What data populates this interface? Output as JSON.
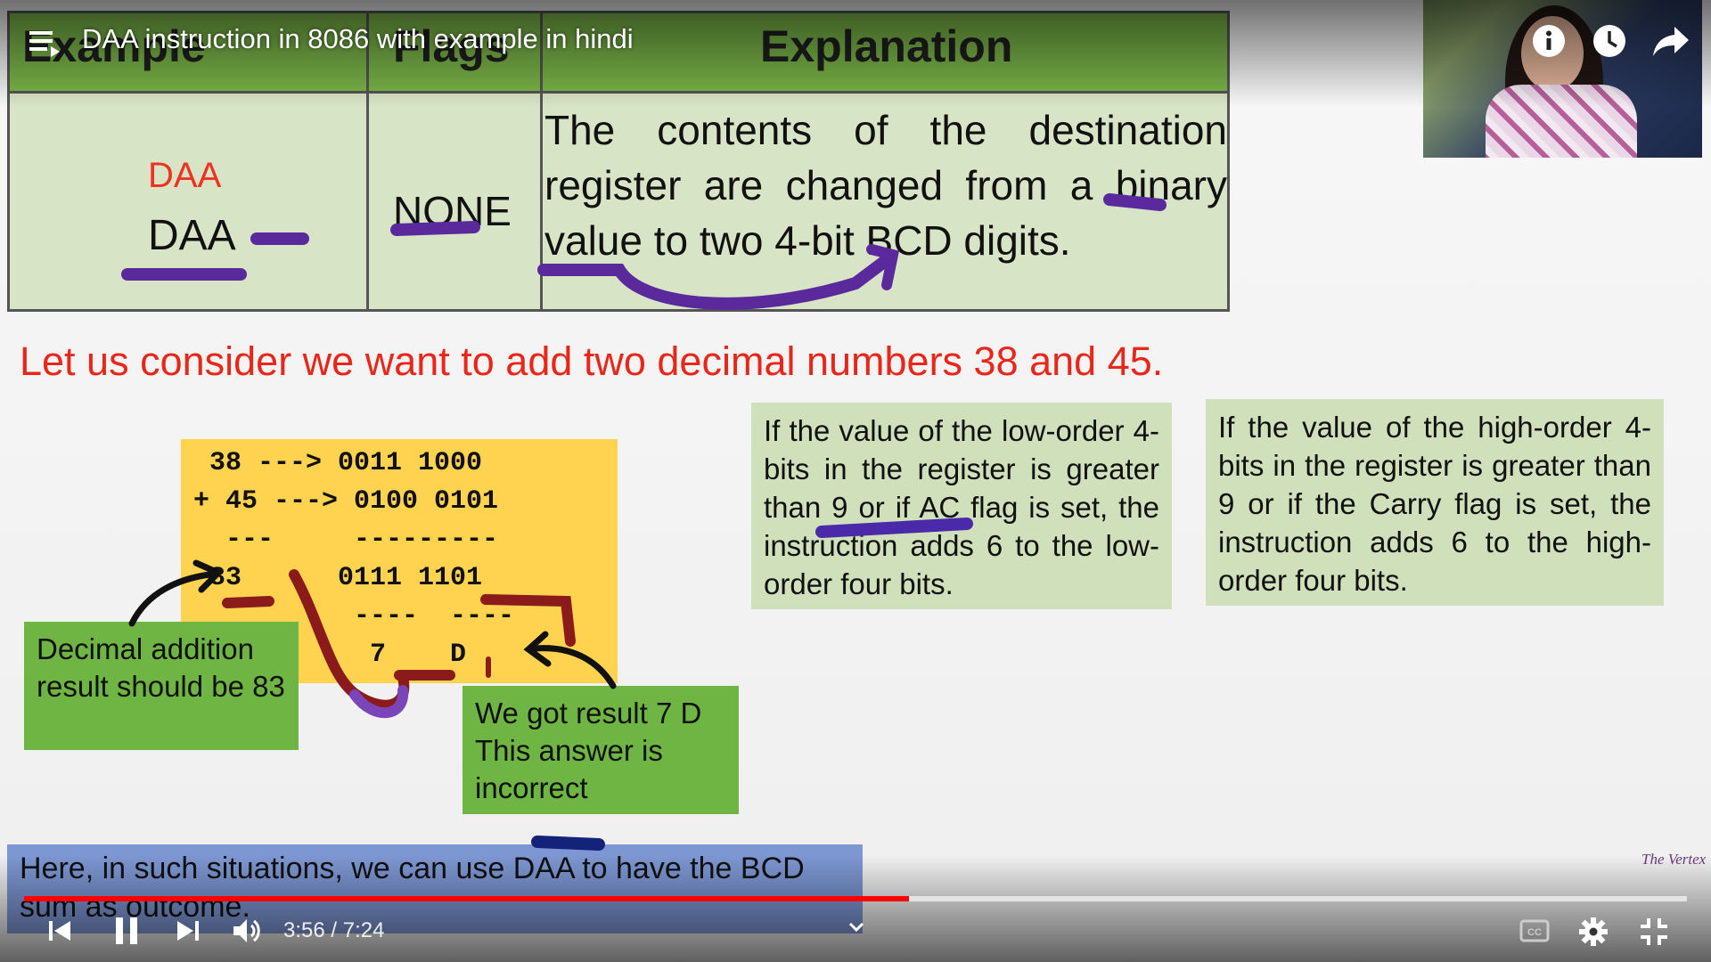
{
  "player": {
    "title": "DAA instruction in 8086 with example in hindi",
    "time": "3:56 / 7:24",
    "progress": 0.532,
    "accent": "#ff0000"
  },
  "table": {
    "headers": [
      "Example",
      "Flags",
      "Explanation"
    ],
    "example_colored": "DAA",
    "example": "DAA",
    "flags": "NONE",
    "explanation": "The contents of the destination register are changed from a binary value to two 4-bit BCD digits."
  },
  "consider": "Let us consider we want to add two decimal numbers 38 and 45.",
  "calc": {
    "lines": [
      " 38 ---> 0011 1000",
      "+ 45 ---> 0100 0101",
      "  ---     ---------",
      " 83      0111 1101",
      "          ----  ----",
      "           7    D"
    ]
  },
  "notes": {
    "decimal_result": "Decimal addition result should be 83",
    "got_result": "We got result 7 D This answer is incorrect",
    "low_order": "If the value of the low-order 4-bits in the register is greater than 9 or if AC flag is set, the instruction adds 6 to the low-order four bits.",
    "high_order": "If the value of the high-order 4-bits in the register is greater than 9 or if the Carry flag is set, the instruction adds 6 to the high-order four bits.",
    "situations": "Here, in such situations, we can use DAA to have the BCD sum as outcome."
  },
  "watermark": "The Vertex",
  "icons": [
    "playlist-icon",
    "info-icon",
    "watch-later-icon",
    "share-icon",
    "previous-icon",
    "pause-icon",
    "next-icon",
    "volume-icon",
    "chevron-down-icon",
    "captions-icon",
    "settings-icon",
    "exit-fullscreen-icon"
  ]
}
